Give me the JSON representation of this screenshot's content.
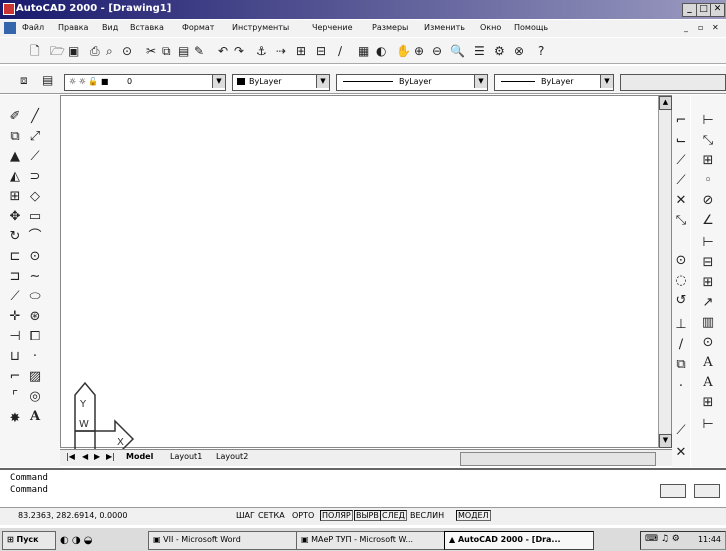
{
  "window": {
    "title": "AutoCAD 2000 - [Drawing1]"
  },
  "menu": [
    "Файл",
    "Правка",
    "Вид",
    "Вставка",
    "Формат",
    "Инструменты",
    "Черчение",
    "Размеры",
    "Изменить",
    "Окно",
    "Помощь"
  ],
  "layer_bar": {
    "layer_name": "0",
    "color": "ByLayer",
    "linetype": "ByLayer",
    "lineweight": "ByLayer"
  },
  "tabs": [
    "Model",
    "Layout1",
    "Layout2"
  ],
  "command": {
    "line1": "Command",
    "line2": "Command"
  },
  "status": {
    "coords": "83.2363, 282.6914, 0.0000",
    "modes": [
      "ШАГ",
      "СЕТКА",
      "ОРТО",
      "ПОЛЯР",
      "ВЫРВ",
      "СЛЕД",
      "ВЕСЛИН",
      "МОДЕЛ"
    ]
  },
  "taskbar": {
    "start": "Пуск",
    "items": [
      "VII - Microsoft Word",
      "МАеР ТУП - Microsoft W...",
      "AutoCAD 2000 - [Dra..."
    ],
    "clock": "11:44"
  },
  "ucs": {
    "x": "X",
    "y": "Y",
    "w": "W"
  }
}
